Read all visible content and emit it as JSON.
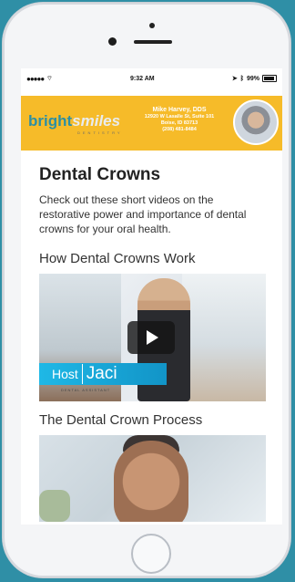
{
  "status_bar": {
    "time": "9:32 AM",
    "battery_text": "99%",
    "signal_dots": "●●●●●",
    "wifi_icon": "wifi",
    "location_icon": "location-arrow",
    "bluetooth_icon": "bluetooth"
  },
  "banner": {
    "logo_primary": "bright",
    "logo_secondary": "smiles",
    "logo_sub": "DENTISTRY",
    "contact": {
      "name": "Mike Harvey, DDS",
      "line1": "12920 W Lasalle St, Suite 101",
      "line2": "Boise, ID 83713",
      "phone": "(208) 481-8484"
    }
  },
  "page": {
    "title": "Dental Crowns",
    "intro": "Check out these short videos on the restorative power and importance of dental crowns for your oral health.",
    "sections": [
      {
        "title": "How Dental Crowns Work",
        "host_label": "Host",
        "host_name": "Jaci",
        "host_subtitle": "DENTAL ASSISTANT"
      },
      {
        "title": "The Dental Crown Process"
      }
    ]
  },
  "colors": {
    "accent": "#f6bb29",
    "teal": "#2f8fa6",
    "video_label": "#1fb8e6"
  }
}
